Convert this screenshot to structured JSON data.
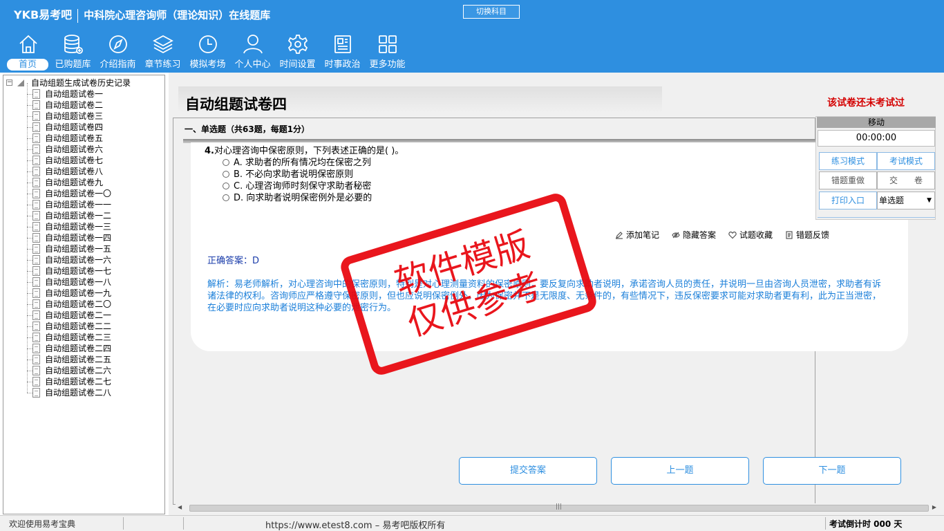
{
  "header": {
    "logo": "YKB易考吧",
    "app_title": "中科院心理咨询师（理论知识）在线题库",
    "switch_subject": "切换科目",
    "nav": [
      {
        "label": "首页",
        "icon": "home-icon",
        "active": true
      },
      {
        "label": "已购题库",
        "icon": "database-icon"
      },
      {
        "label": "介绍指南",
        "icon": "compass-icon"
      },
      {
        "label": "章节练习",
        "icon": "layers-icon"
      },
      {
        "label": "模拟考场",
        "icon": "clock-icon"
      },
      {
        "label": "个人中心",
        "icon": "user-icon"
      },
      {
        "label": "时间设置",
        "icon": "gear-icon"
      },
      {
        "label": "时事政治",
        "icon": "news-icon"
      },
      {
        "label": "更多功能",
        "icon": "grid-icon"
      }
    ]
  },
  "sidebar": {
    "root": "自动组题生成试卷历史记录",
    "items": [
      "自动组题试卷一",
      "自动组题试卷二",
      "自动组题试卷三",
      "自动组题试卷四",
      "自动组题试卷五",
      "自动组题试卷六",
      "自动组题试卷七",
      "自动组题试卷八",
      "自动组题试卷九",
      "自动组题试卷一〇",
      "自动组题试卷一一",
      "自动组题试卷一二",
      "自动组题试卷一三",
      "自动组题试卷一四",
      "自动组题试卷一五",
      "自动组题试卷一六",
      "自动组题试卷一七",
      "自动组题试卷一八",
      "自动组题试卷一九",
      "自动组题试卷二〇",
      "自动组题试卷二一",
      "自动组题试卷二二",
      "自动组题试卷二三",
      "自动组题试卷二四",
      "自动组题试卷二五",
      "自动组题试卷二六",
      "自动组题试卷二七",
      "自动组题试卷二八"
    ]
  },
  "main": {
    "paper_title": "自动组题试卷四",
    "exam_status": "该试卷还未考试过",
    "section_header": "一、单选题（共63题，每题1分）",
    "question": {
      "number": "4.",
      "text": "对心理咨询中保密原则，下列表述正确的是(  )。",
      "options": [
        "A. 求助者的所有情况均在保密之列",
        "B. 不必向求助者说明保密原则",
        "C. 心理咨询师时刻保守求助者秘密",
        "D. 向求助者说明保密例外是必要的"
      ]
    },
    "actions": [
      "添加笔记",
      "隐藏答案",
      "试题收藏",
      "错题反馈"
    ],
    "answer": "正确答案：D",
    "analysis": "解析：易老师解析，对心理咨询中的保密原则，特别是对心理测量资料的保密原则，要反复向求助者说明，承诺咨询人员的责任，并说明一旦由咨询人员泄密，求助者有诉诸法律的权利。咨询师应严格遵守保密原则，但也应说明保密例外。因为保密并不是无限度、无条件的，有些情况下，违反保密要求可能对求助者更有利，此为正当泄密，在必要时应向求助者说明这种必要的泄密行为。",
    "buttons": {
      "submit": "提交答案",
      "prev": "上一题",
      "next": "下一题"
    }
  },
  "panel": {
    "move": "移动",
    "timer": "00:00:00",
    "practice_mode": "练习模式",
    "exam_mode": "考试模式",
    "redo_wrong": "错题重做",
    "hand_in": "交　　卷",
    "print": "打印入口",
    "type_select": "单选题"
  },
  "watermark": {
    "line1": "软件模版",
    "line2": "仅供参考"
  },
  "status": {
    "welcome": "欢迎使用易考宝典",
    "url": "https://www.etest8.com – 易考吧版权所有",
    "countdown": "考试倒计时 000 天"
  },
  "colors": {
    "header_bg": "#2e8fe0",
    "status_red": "#d40000",
    "answer": "#1a3caa",
    "analysis": "#1b7fd9",
    "watermark": "#e8050c"
  }
}
